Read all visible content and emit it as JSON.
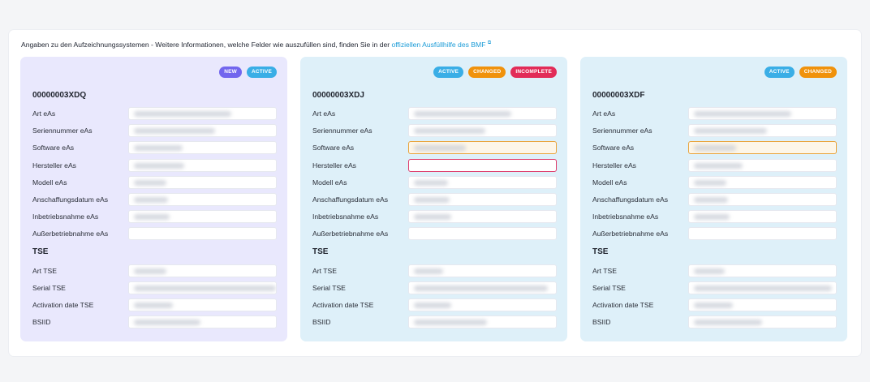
{
  "intro": {
    "text": "Angaben zu den Aufzeichnungssystemen - Weitere Informationen, welche Felder wie auszufüllen sind, finden Sie in der ",
    "link": "offiziellen Ausfüllhilfe des BMF",
    "link_icon": "external-link-icon"
  },
  "colors": {
    "new": "#7266ee",
    "active": "#3aaee6",
    "changed": "#f0920c",
    "incomplete": "#e22c58",
    "link": "#1a9bd7",
    "card_purple": "#e9e8fd",
    "card_blue": "#def0f9"
  },
  "cards": [
    {
      "id": "00000003XDQ",
      "badges": [
        "NEW",
        "ACTIVE"
      ],
      "eas_fields": [
        {
          "label": "Art eAs",
          "value_state": "blurred"
        },
        {
          "label": "Seriennummer eAs",
          "value_state": "blurred"
        },
        {
          "label": "Software eAs",
          "value_state": "blurred"
        },
        {
          "label": "Hersteller eAs",
          "value_state": "blurred"
        },
        {
          "label": "Modell eAs",
          "value_state": "blurred"
        },
        {
          "label": "Anschaffungsdatum eAs",
          "value_state": "blurred"
        },
        {
          "label": "Inbetriebsnahme eAs",
          "value_state": "blurred"
        },
        {
          "label": "Außerbetriebnahme eAs",
          "value_state": "empty"
        }
      ],
      "tse_title": "TSE",
      "tse_fields": [
        {
          "label": "Art TSE",
          "value_state": "blurred"
        },
        {
          "label": "Serial TSE",
          "value_state": "blurred"
        },
        {
          "label": "Activation date TSE",
          "value_state": "blurred"
        },
        {
          "label": "BSIID",
          "value_state": "blurred"
        }
      ]
    },
    {
      "id": "00000003XDJ",
      "badges": [
        "ACTIVE",
        "CHANGED",
        "INCOMPLETE"
      ],
      "eas_fields": [
        {
          "label": "Art eAs",
          "value_state": "blurred"
        },
        {
          "label": "Seriennummer eAs",
          "value_state": "blurred"
        },
        {
          "label": "Software eAs",
          "value_state": "blurred",
          "highlight": "changed"
        },
        {
          "label": "Hersteller eAs",
          "value_state": "empty",
          "highlight": "incomplete"
        },
        {
          "label": "Modell eAs",
          "value_state": "blurred"
        },
        {
          "label": "Anschaffungsdatum eAs",
          "value_state": "blurred"
        },
        {
          "label": "Inbetriebsnahme eAs",
          "value_state": "blurred"
        },
        {
          "label": "Außerbetriebnahme eAs",
          "value_state": "empty"
        }
      ],
      "tse_title": "TSE",
      "tse_fields": [
        {
          "label": "Art TSE",
          "value_state": "blurred"
        },
        {
          "label": "Serial TSE",
          "value_state": "blurred"
        },
        {
          "label": "Activation date TSE",
          "value_state": "blurred"
        },
        {
          "label": "BSIID",
          "value_state": "blurred"
        }
      ]
    },
    {
      "id": "00000003XDF",
      "badges": [
        "ACTIVE",
        "CHANGED"
      ],
      "eas_fields": [
        {
          "label": "Art eAs",
          "value_state": "blurred"
        },
        {
          "label": "Seriennummer eAs",
          "value_state": "blurred"
        },
        {
          "label": "Software eAs",
          "value_state": "blurred",
          "highlight": "changed"
        },
        {
          "label": "Hersteller eAs",
          "value_state": "blurred"
        },
        {
          "label": "Modell eAs",
          "value_state": "blurred"
        },
        {
          "label": "Anschaffungsdatum eAs",
          "value_state": "blurred"
        },
        {
          "label": "Inbetriebsnahme eAs",
          "value_state": "blurred"
        },
        {
          "label": "Außerbetriebnahme eAs",
          "value_state": "empty"
        }
      ],
      "tse_title": "TSE",
      "tse_fields": [
        {
          "label": "Art TSE",
          "value_state": "blurred"
        },
        {
          "label": "Serial TSE",
          "value_state": "blurred"
        },
        {
          "label": "Activation date TSE",
          "value_state": "blurred"
        },
        {
          "label": "BSIID",
          "value_state": "blurred"
        }
      ]
    }
  ]
}
